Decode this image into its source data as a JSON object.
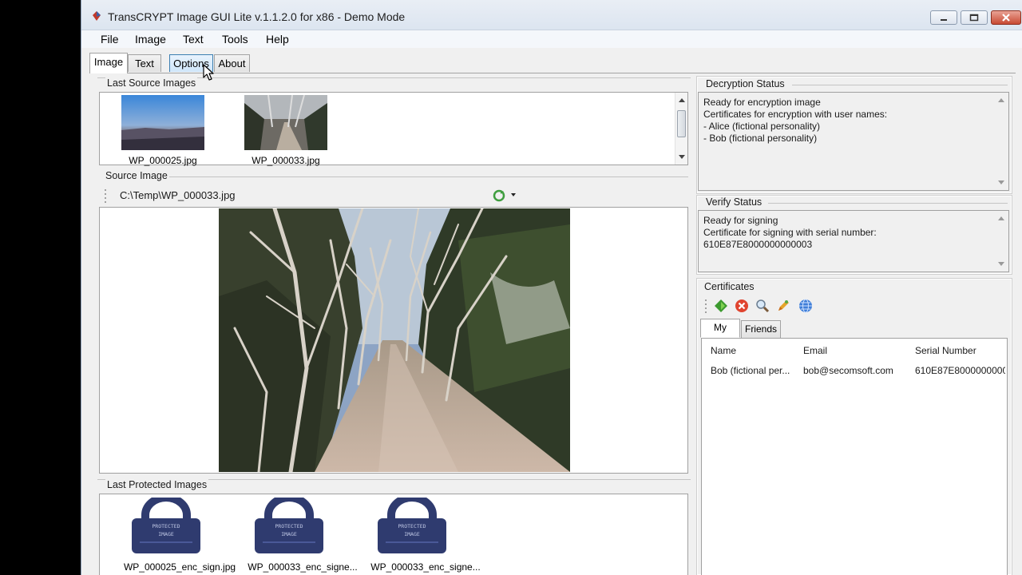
{
  "window": {
    "title": "TransCRYPT Image GUI Lite v.1.1.2.0 for x86 - Demo Mode"
  },
  "menu": [
    "File",
    "Image",
    "Text",
    "Tools",
    "Help"
  ],
  "tabs": [
    {
      "label": "Image",
      "active": true
    },
    {
      "label": "Text",
      "active": false
    },
    {
      "label": "Options",
      "active": false
    },
    {
      "label": "About",
      "active": false
    }
  ],
  "last_source": {
    "label": "Last Source Images",
    "items": [
      "WP_000025.jpg",
      "WP_000033.jpg"
    ]
  },
  "source_image": {
    "label": "Source Image",
    "path": "C:\\Temp\\WP_000033.jpg"
  },
  "last_protected": {
    "label": "Last Protected Images",
    "items": [
      "WP_000025_enc_sign.jpg",
      "WP_000033_enc_signe...",
      "WP_000033_enc_signe..."
    ],
    "lock_text": "PROTECTED IMAGE"
  },
  "decryption": {
    "label": "Decryption Status",
    "lines": [
      "Ready for encryption image",
      "Certificates for encryption with user names:",
      " - Alice (fictional personality)",
      " - Bob (fictional personality)"
    ]
  },
  "verify": {
    "label": "Verify Status",
    "lines": [
      "Ready for signing",
      "Certificate for signing with serial number:",
      "610E87E8000000000003"
    ]
  },
  "certificates": {
    "label": "Certificates",
    "tabs": [
      "My",
      "Friends"
    ],
    "columns": [
      "Name",
      "Email",
      "Serial Number"
    ],
    "rows": [
      {
        "name": "Bob (fictional per...",
        "email": "bob@secomsoft.com",
        "serial": "610E87E8000000000"
      }
    ],
    "toolbar_icons": [
      "add-green-arrow-icon",
      "delete-red-x-icon",
      "search-magnifier-icon",
      "edit-pen-icon",
      "globe-icon"
    ]
  },
  "colors": {
    "lock_body": "#2f3b6f",
    "lock_text": "#bfc7e4"
  }
}
